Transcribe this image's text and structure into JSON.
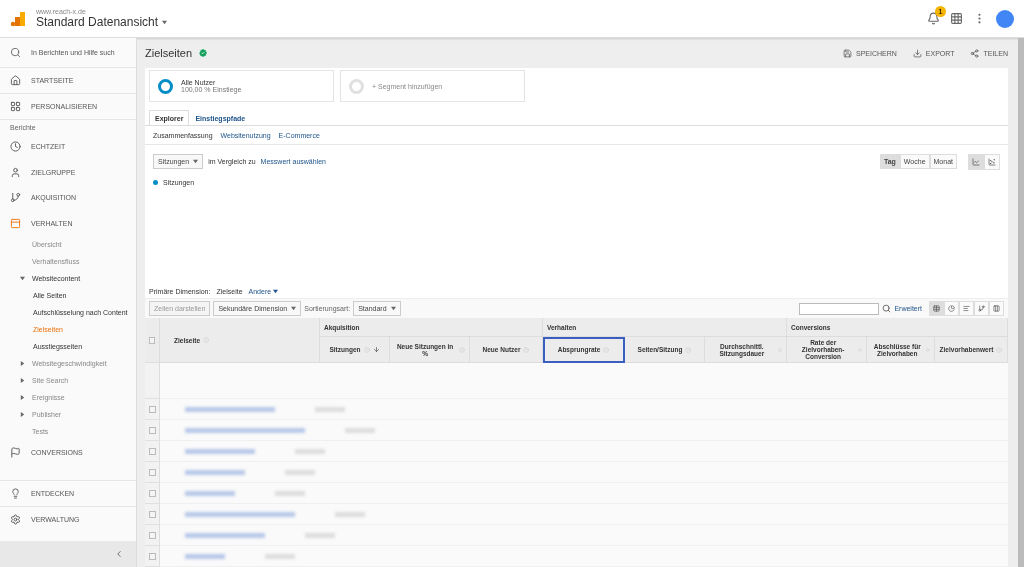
{
  "header": {
    "site": "www.reach-x.de",
    "view": "Standard Datenansicht",
    "notification_count": "1"
  },
  "sidebar": {
    "search_placeholder": "In Berichten und Hilfe such",
    "top_items": [
      {
        "label": "STARTSEITE"
      },
      {
        "label": "PERSONALISIEREN"
      }
    ],
    "section": "Berichte",
    "items": [
      {
        "label": "ECHTZEIT",
        "expanded": false
      },
      {
        "label": "ZIELGRUPPE",
        "expanded": false
      },
      {
        "label": "AKQUISITION",
        "expanded": false
      },
      {
        "label": "VERHALTEN",
        "expanded": true,
        "children": [
          {
            "label": "Übersicht",
            "selected": false
          },
          {
            "label": "Verhaltensfluss",
            "selected": false
          },
          {
            "label": "Websitecontent",
            "selected": false,
            "expanded": true,
            "children": [
              {
                "label": "Alle Seiten",
                "selected": false
              },
              {
                "label": "Aufschlüsselung nach Content",
                "selected": false
              },
              {
                "label": "Zielseiten",
                "selected": true
              },
              {
                "label": "Ausstiegsseiten",
                "selected": false
              }
            ]
          },
          {
            "label": "Websitegeschwindigkeit",
            "selected": false,
            "expanded": false
          },
          {
            "label": "Site Search",
            "selected": false,
            "expanded": false
          },
          {
            "label": "Ereignisse",
            "selected": false,
            "expanded": false
          },
          {
            "label": "Publisher",
            "selected": false,
            "expanded": false
          },
          {
            "label": "Tests",
            "selected": false
          }
        ]
      },
      {
        "label": "CONVERSIONS",
        "expanded": false
      }
    ],
    "bottom_items": [
      {
        "label": "ENTDECKEN"
      },
      {
        "label": "VERWALTUNG"
      }
    ]
  },
  "report": {
    "title": "Zielseiten",
    "actions": [
      "SPEICHERN",
      "EXPORT",
      "TEILEN"
    ]
  },
  "segments": [
    {
      "name": "Alle Nutzer",
      "detail": "100,00 % Einstiege",
      "active": true
    },
    {
      "name": "+ Segment hinzufügen",
      "active": false
    }
  ],
  "tabs": [
    {
      "label": "Explorer",
      "selected": true
    },
    {
      "label": "Einstiegspfade",
      "selected": false
    }
  ],
  "subtabs": [
    {
      "label": "Zusammenfassung",
      "selected": true
    },
    {
      "label": "Websitenutzung",
      "selected": false
    },
    {
      "label": "E-Commerce",
      "selected": false
    }
  ],
  "graph": {
    "metric": "Sitzungen",
    "compare_text": "im Vergleich zu",
    "compare_link": "Messwert auswählen",
    "legend": "Sitzungen",
    "periods": [
      {
        "label": "Tag",
        "selected": true
      },
      {
        "label": "Woche",
        "selected": false
      },
      {
        "label": "Monat",
        "selected": false
      }
    ],
    "chart_types": [
      {
        "selected": true
      },
      {
        "selected": false
      }
    ]
  },
  "dimension": {
    "label": "Primäre Dimension:",
    "value": "Zielseite",
    "other": "Andere"
  },
  "toolbar": {
    "plot_rows": "Zeilen darstellen",
    "secondary": "Sekundäre Dimension",
    "sort_label": "Sortierungsart:",
    "sort_value": "Standard",
    "advanced": "Erweitert",
    "views": [
      {
        "selected": true
      },
      {
        "selected": false
      },
      {
        "selected": false
      },
      {
        "selected": false
      },
      {
        "selected": false
      }
    ]
  },
  "table": {
    "all_checked": false,
    "first_column": "Zielseite",
    "groups": [
      {
        "label": "Akquisition"
      },
      {
        "label": "Verhalten"
      },
      {
        "label": "Conversions"
      }
    ],
    "columns": [
      {
        "label": "Sitzungen",
        "sorted": true,
        "highlighted": false
      },
      {
        "label": "Neue Sitzungen in %",
        "sorted": false,
        "highlighted": false
      },
      {
        "label": "Neue Nutzer",
        "sorted": false,
        "highlighted": false
      },
      {
        "label": "Absprungrate",
        "sorted": false,
        "highlighted": true
      },
      {
        "label": "Seiten/Sitzung",
        "sorted": false,
        "highlighted": false
      },
      {
        "label": "Durchschnittl. Sitzungsdauer",
        "sorted": false,
        "highlighted": false
      },
      {
        "label": "Rate der Zielvorhaben-Conversion",
        "sorted": false,
        "highlighted": false
      },
      {
        "label": "Abschlüsse für Zielvorhaben",
        "sorted": false,
        "highlighted": false
      },
      {
        "label": "Zielvorhabenwert",
        "sorted": false,
        "highlighted": false
      }
    ],
    "rows": [
      {
        "checked": false
      },
      {
        "checked": false
      },
      {
        "checked": false
      },
      {
        "checked": false
      },
      {
        "checked": false
      },
      {
        "checked": false
      },
      {
        "checked": false
      },
      {
        "checked": false
      }
    ]
  }
}
